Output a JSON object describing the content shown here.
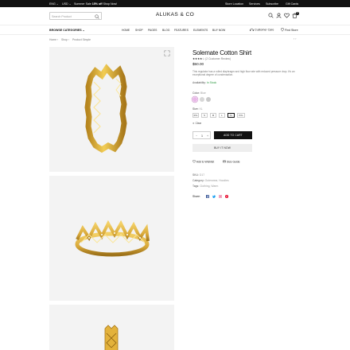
{
  "topbar": {
    "language": "ENG",
    "currency": "USD",
    "promo_prefix": "Summer Sale",
    "promo_bold": "15% off",
    "promo_link": "Shop Now!",
    "links": [
      "Store Location",
      "Services",
      "Subscribe",
      "Gift Cards"
    ]
  },
  "header": {
    "search_placeholder": "Search Product",
    "logo": "ALUKAS & CO",
    "cart_count": "0"
  },
  "nav": {
    "browse": "BROWSE CATEGORIES",
    "items": [
      "HOME",
      "SHOP",
      "PAGES",
      "BLOG",
      "FEATURES",
      "ELEMENTS",
      "BUY NOW"
    ],
    "customer_care": "Customer Care",
    "find_store": "Find Store"
  },
  "breadcrumb": [
    "Home",
    "Shop",
    "Product Simple"
  ],
  "product": {
    "title": "Solemate Cotton Shirt",
    "rating_stars": "★★★★☆",
    "reviews": "(2 Customer Review)",
    "price": "$50.00",
    "description": "This regulator has a rolled diaphragm and high flow rate with reduced pressure drop. It's an exceptional degree of condensation.",
    "availability_label": "Availability:",
    "availability_value": "In Stock",
    "color_label": "Color:",
    "color_value": "Blue",
    "colors": [
      "#e9b8e8",
      "#d7d7d7",
      "#c9c9c9"
    ],
    "size_label": "Size:",
    "size_value": "XL",
    "sizes": [
      "4XL",
      "S",
      "M",
      "L",
      "XL",
      "XXL"
    ],
    "selected_size": "XL",
    "clear": "Clear",
    "qty": "1",
    "qty_minus": "−",
    "qty_plus": "+",
    "add_to_cart": "ADD TO CART",
    "buy_now": "BUY IT NOW",
    "wishlist": "Add to Wishlist",
    "size_guide": "Size Guide",
    "sku_label": "SKU:",
    "sku": "D17",
    "category_label": "Category:",
    "categories": "Outerwear, Hoodies",
    "tags_label": "Tags:",
    "tags": "Clothing, Warm",
    "share_label": "Share:"
  },
  "colors": {
    "accent": "#111111",
    "stock_green": "#2e9a43",
    "gold": "#e3b23c",
    "facebook": "#3b5998",
    "twitter": "#1da1f2",
    "instagram": "#e1306c",
    "pinterest": "#e60023"
  }
}
